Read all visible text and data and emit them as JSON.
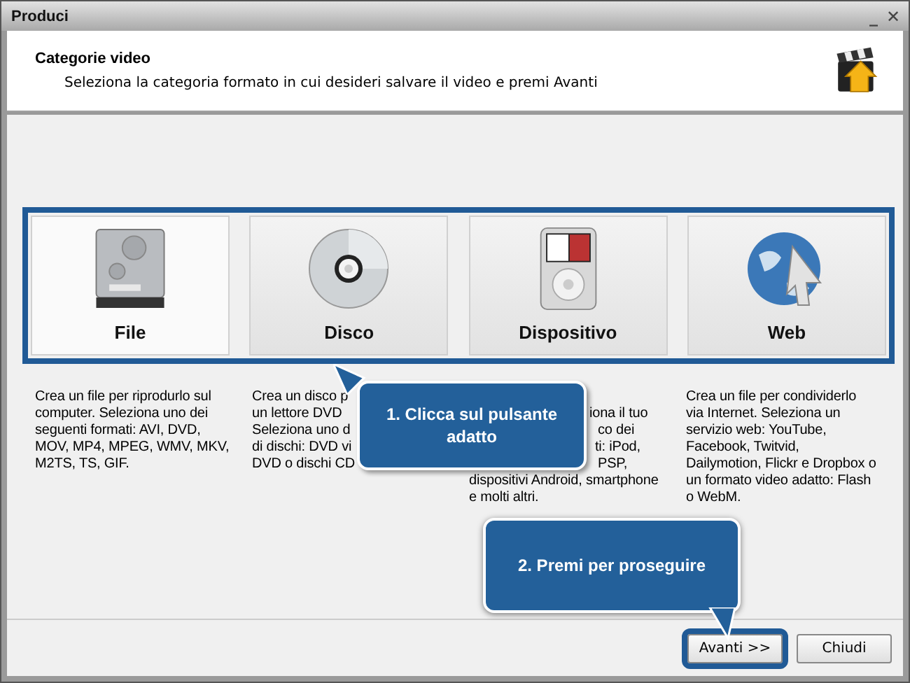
{
  "window": {
    "title": "Produci",
    "controls": [
      "_",
      "✕"
    ]
  },
  "header": {
    "title": "Categorie video",
    "subtitle": "Seleziona la categoria formato in cui desideri salvare il video e premi Avanti"
  },
  "categories": [
    {
      "kind": "drive",
      "label": "File",
      "selected": true,
      "description_lines": [
        "Crea un file per riprodurlo sul",
        "computer. Seleziona uno dei",
        "seguenti formati: AVI, DVD,",
        "MOV, MP4, MPEG, WMV, MKV,",
        "M2TS, TS, GIF."
      ]
    },
    {
      "kind": "disc",
      "label": "Disco",
      "selected": false,
      "description_lines": [
        "Crea un disco p",
        "un lettore DVD",
        "Seleziona uno d",
        "di dischi: DVD vi",
        "DVD o dischi CD"
      ]
    },
    {
      "kind": "player",
      "label": "Dispositivo",
      "selected": false,
      "description_lines": [
        "iona il tuo",
        "co dei",
        "ti: iPod,",
        "PSP,",
        "dispositivi Android, smartphone",
        "e molti altri."
      ]
    },
    {
      "kind": "globe",
      "label": "Web",
      "selected": false,
      "description_lines": [
        "Crea un file per condividerlo",
        "via Internet. Seleziona un",
        "servizio web: YouTube,",
        "Facebook, Twitvid,",
        "Dailymotion, Flickr e Dropbox o",
        "un formato video adatto: Flash",
        "o WebM."
      ]
    }
  ],
  "callouts": [
    "1. Clicca sul pulsante adatto",
    "2. Premi per proseguire"
  ],
  "buttons": [
    {
      "label": "Avanti >>",
      "highlighted": true
    },
    {
      "label": "Chiudi",
      "highlighted": false
    }
  ]
}
